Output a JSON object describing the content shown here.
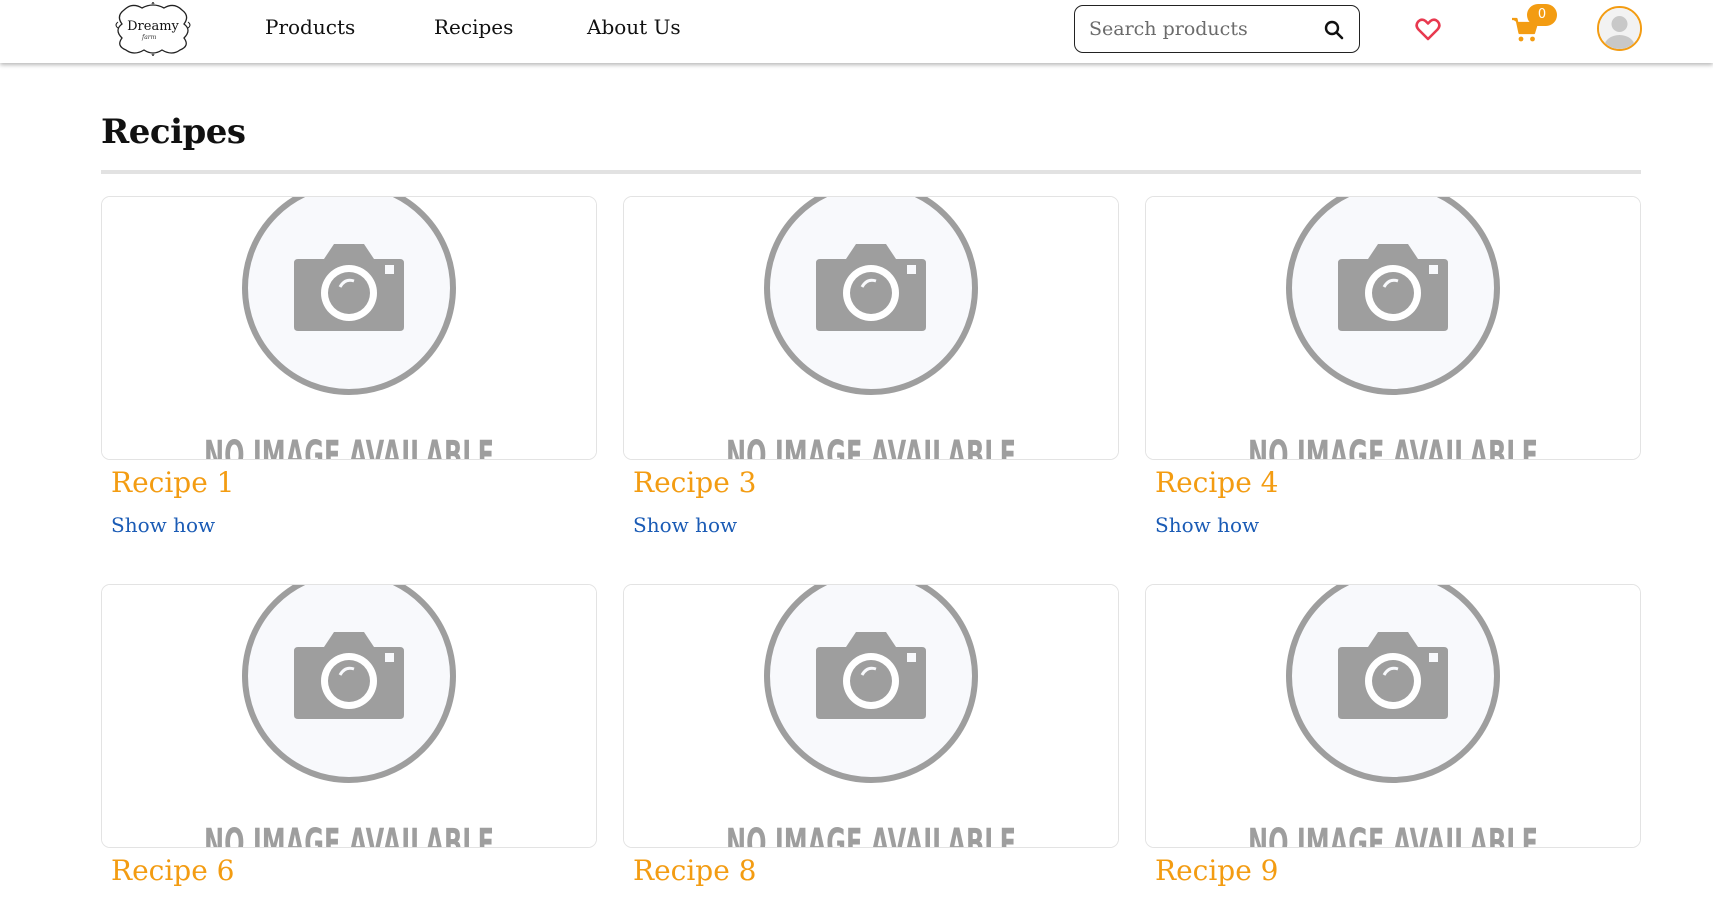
{
  "header": {
    "logo_text": "Dreamy",
    "logo_sub": "farm",
    "nav": [
      "Products",
      "Recipes",
      "About Us"
    ],
    "search": {
      "placeholder": "Search products",
      "value": ""
    },
    "cart_count": "0",
    "icons": [
      "search-icon",
      "heart-icon",
      "cart-icon",
      "user-avatar-icon"
    ],
    "colors": {
      "accent": "#f39c12",
      "heart": "#e8394f",
      "link": "#1a5bb5"
    }
  },
  "main": {
    "title": "Recipes",
    "placeholder_text": "NO IMAGE AVAILABLE",
    "show_how_label": "Show how",
    "recipes": [
      {
        "name": "Recipe 1"
      },
      {
        "name": "Recipe 3"
      },
      {
        "name": "Recipe 4"
      },
      {
        "name": "Recipe 6"
      },
      {
        "name": "Recipe 8"
      },
      {
        "name": "Recipe 9"
      }
    ]
  }
}
